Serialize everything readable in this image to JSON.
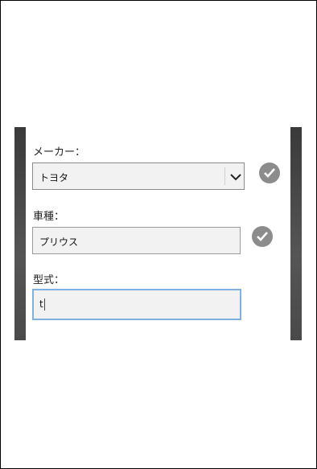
{
  "form": {
    "maker_label": "メーカー：",
    "maker_value": "トヨタ",
    "model_label": "車種：",
    "model_value": "プリウス",
    "type_label": "型式：",
    "type_value": "t"
  },
  "icons": {
    "select_arrow": "chevron-down-icon",
    "valid": "check-circle-icon"
  },
  "colors": {
    "focus_border": "#7fb0e0",
    "check_bg": "#8c8c8c",
    "side_bar": "#4a4a4a"
  }
}
